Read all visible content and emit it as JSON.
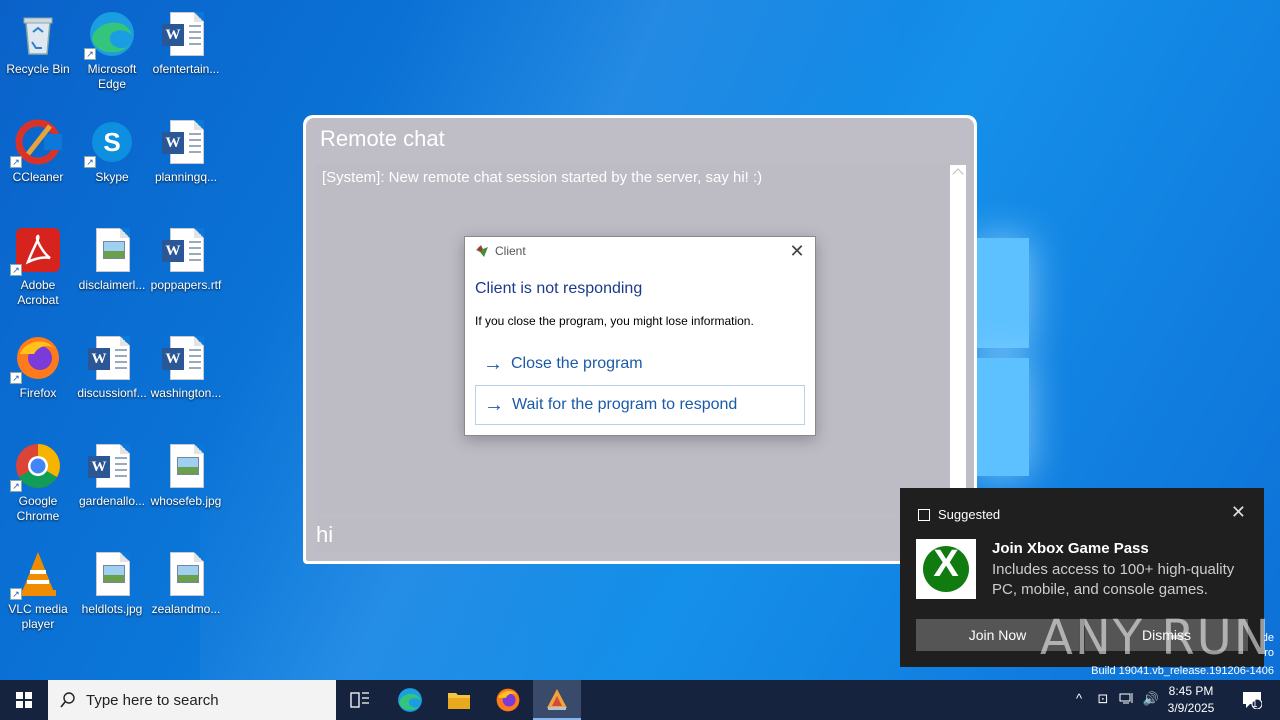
{
  "desktop": {
    "icons": [
      {
        "label": "Recycle Bin"
      },
      {
        "label": "Microsoft Edge"
      },
      {
        "label": "ofentertain..."
      },
      {
        "label": "CCleaner"
      },
      {
        "label": "Skype"
      },
      {
        "label": "planningq..."
      },
      {
        "label": "Adobe Acrobat"
      },
      {
        "label": "disclaimerl..."
      },
      {
        "label": "poppapers.rtf"
      },
      {
        "label": "Firefox"
      },
      {
        "label": "discussionf..."
      },
      {
        "label": "washington..."
      },
      {
        "label": "Google Chrome"
      },
      {
        "label": "gardenallo..."
      },
      {
        "label": "whosefeb.jpg"
      },
      {
        "label": "VLC media player"
      },
      {
        "label": "heldlots.jpg"
      },
      {
        "label": "zealandmo..."
      }
    ]
  },
  "chat_window": {
    "title": "Remote chat",
    "message": "[System]: New remote chat session started by the server, say hi! :)",
    "input_value": "hi"
  },
  "dialog": {
    "title": "Client",
    "heading": "Client is not responding",
    "subtext": "If you close the program, you might lose information.",
    "option_close": "Close the program",
    "option_wait": "Wait for the program to respond"
  },
  "toast": {
    "category": "Suggested",
    "title": "Join Xbox Game Pass",
    "body": "Includes access to 100+ high-quality PC, mobile, and console games.",
    "join_label": "Join Now",
    "dismiss_label": "Dismiss"
  },
  "watermark": "ANY RUN",
  "edge_text_1": "de",
  "edge_text_2": "ro",
  "build": "Build 19041.vb_release.191206-1406",
  "taskbar": {
    "search_placeholder": "Type here to search",
    "time": "8:45 PM",
    "date": "3/9/2025",
    "notification_count": "1"
  },
  "colors": {
    "desktop_blue": "#0b78da",
    "chat_bg": "#bfbdc6",
    "dialog_heading": "#1a3a8c",
    "link_blue": "#1a5aa8",
    "taskbar": "#16233f",
    "xbox_green": "#107c10"
  }
}
